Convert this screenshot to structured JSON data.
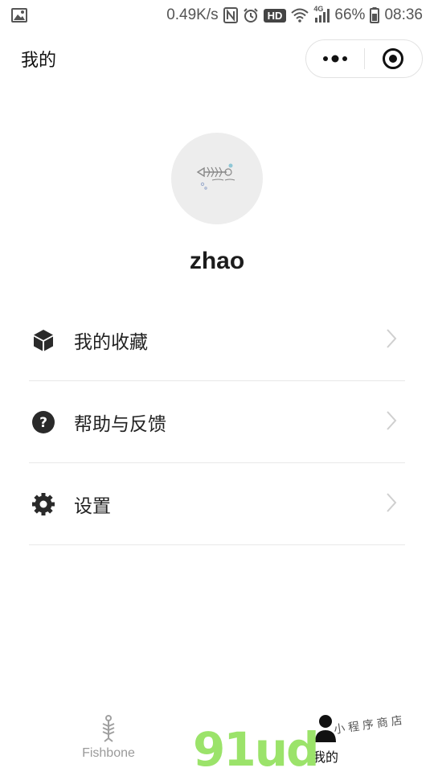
{
  "status_bar": {
    "speed": "0.49K/s",
    "hd": "HD",
    "network": "4G",
    "battery": "66%",
    "time": "08:36"
  },
  "header": {
    "title": "我的"
  },
  "profile": {
    "username": "zhao"
  },
  "menu": [
    {
      "label": "我的收藏",
      "icon": "cube-icon"
    },
    {
      "label": "帮助与反馈",
      "icon": "help-icon"
    },
    {
      "label": "设置",
      "icon": "settings-icon"
    }
  ],
  "tabs": [
    {
      "label": "Fishbone",
      "icon": "fishbone-icon",
      "active": false
    },
    {
      "label": "我的",
      "icon": "user-icon",
      "active": true
    }
  ],
  "watermark": {
    "brand": "91ud.com",
    "tagline": "小程序商店"
  },
  "colors": {
    "watermark_green": "#9be36a",
    "watermark_orange": "#f0a24a",
    "icon_dark": "#2a2a2a"
  }
}
